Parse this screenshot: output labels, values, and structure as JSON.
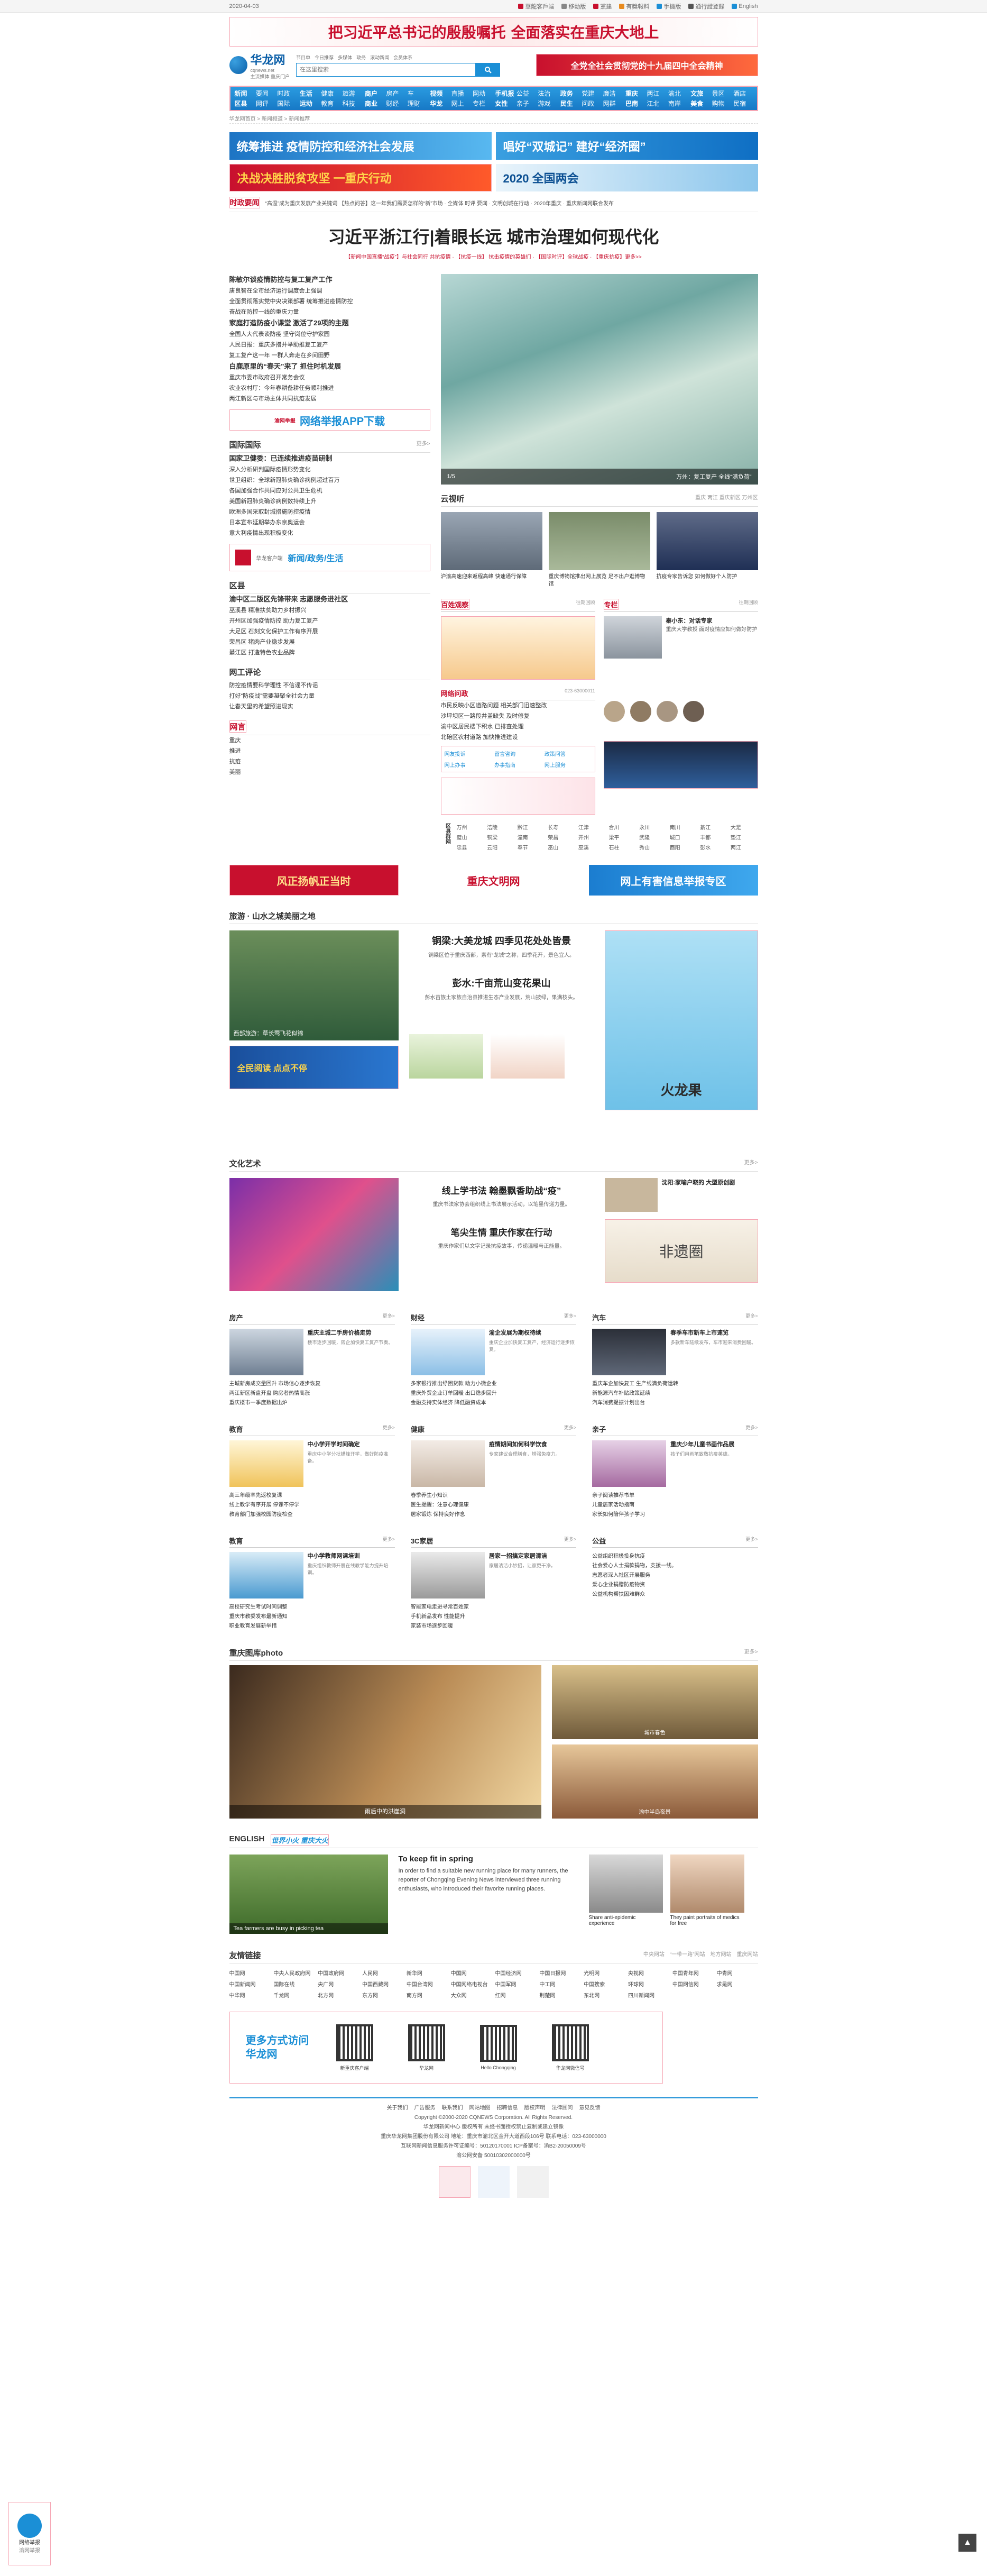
{
  "topbar": {
    "date": "2020-04-03",
    "links": [
      "華龍客戶端",
      "移動版",
      "黨建",
      "有獎報料",
      "手機版",
      "通行證登錄",
      "English"
    ]
  },
  "banner": {
    "text": "把习近平总书记的殷殷嘱托 全面落实在重庆大地上"
  },
  "header": {
    "logo_title": "华龙网",
    "logo_sub": "cqnews.net",
    "tagline": "主流媒体 重庆门户",
    "search_placeholder": "在这里搜索",
    "ad_text": "全党全社会贯彻党的十九届四中全会精神",
    "top_links": [
      "节目单",
      "今日推荐",
      "多媒体",
      "政务",
      "滚动新闻",
      "会员体系"
    ]
  },
  "nav": {
    "cols": [
      [
        "新闻",
        "要闻",
        "时政",
        "区县",
        "网评",
        "国际",
        "社会",
        "娱乐",
        "图片"
      ],
      [
        "生活",
        "健康",
        "旅游",
        "运动",
        "教育",
        "科技",
        "时尚",
        "文化",
        "美食"
      ],
      [
        "商户",
        "房产",
        "车",
        "商业",
        "财经",
        "理财",
        "互联",
        "数码",
        "专题"
      ],
      [
        "视频",
        "直播",
        "网动",
        "华龙",
        "网上",
        "专栏",
        "微博",
        "微信",
        "APP"
      ],
      [
        "手机报",
        "公益",
        "法治",
        "女性",
        "亲子",
        "游戏",
        "电竞",
        "音乐",
        "招聘"
      ],
      [
        "政务",
        "党建",
        "廉洁",
        "民生",
        "问政",
        "网群",
        "信用",
        "人社",
        "政策"
      ],
      [
        "重庆",
        "两江",
        "渝北",
        "巴南",
        "江北",
        "南岸",
        "渝中",
        "沙坪坝",
        "九龙坡"
      ],
      [
        "文旅",
        "景区",
        "酒店",
        "美食",
        "购物",
        "民宿",
        "节庆",
        "攻略",
        "专栏"
      ]
    ]
  },
  "crumb": "华龙网首页 > 新闻频道 > 新闻推荐",
  "promos": {
    "p1": "统筹推进 疫情防控和经济社会发展",
    "p2": "唱好“双城记” 建好“经济圈”",
    "p3": "决战决胜脱贫攻坚 一重庆行动",
    "p4": "2020 全国两会"
  },
  "ticker": {
    "label": "时政要闻",
    "text": "“高温”成为重庆发展产业关键词 【热点问答】这一年我们需要怎样的“新”市场 · 全媒体 时评 要闻 · 文明创城在行动 · 2020年重庆 · 重庆新闻网联合发布"
  },
  "headline": {
    "title": "习近平浙江行|着眼长远 城市治理如何现代化",
    "sub": "【新闻中国直播“战疫”】与社会同行 共抗疫情 · 【抗疫一线】 抗击疫情的英雄们 · 【国际时评】全球战疫 · 【重庆抗疫】更多>>"
  },
  "left_news": [
    {
      "t": "陈敏尔谈疫情防控与复工复产工作",
      "b": true
    },
    {
      "t": "唐良智在全市经济运行调度会上强调",
      "b": false
    },
    {
      "t": "全面贯彻落实党中央决策部署 统筹推进疫情防控",
      "b": false
    },
    {
      "t": "奋战在防控一线的重庆力量",
      "b": false
    },
    {
      "t": "家庭打造防疫小课堂 激活了29项的主题",
      "b": true
    },
    {
      "t": "全国人大代表谈防疫 坚守岗位守护家园",
      "b": false
    },
    {
      "t": "人民日报：重庆多措并举助推复工复产",
      "b": false
    },
    {
      "t": "复工复产这一年 一群人奔走在乡间田野",
      "b": false
    },
    {
      "t": "白鹿原里的“春天”来了 抓住时机发展",
      "b": true
    },
    {
      "t": "重庆市委市政府召开常务会议",
      "b": false
    },
    {
      "t": "农业农村厅：今年春耕备耕任务顺利推进",
      "b": false
    },
    {
      "t": "两江新区与市场主体共同抗疫发展",
      "b": false
    }
  ],
  "app_btn": {
    "text": "网络举报APP下载",
    "r": "渝网举报"
  },
  "slider": {
    "caption": "万州：复工复产 全线“满负荷”",
    "page": "1/5"
  },
  "cloud": {
    "title": "云视听",
    "tabs": [
      "重庆",
      "两江",
      "重庆新区",
      "万州区"
    ],
    "items": [
      {
        "t": "沪渝高速迎来返程高峰 快速通行保障"
      },
      {
        "t": "重庆博物馆推出网上展览 足不出户逛博物馆"
      },
      {
        "t": "抗疫专家告诉您 如何做好个人防护"
      }
    ]
  },
  "intl": {
    "title": "国际国际",
    "more": "更多>",
    "list": [
      "国家卫健委：已连续推进疫苗研制",
      "深入分析研判国际疫情形势变化",
      "世卫组织：全球新冠肺炎确诊病例超过百万",
      "各国加强合作共同应对公共卫生危机",
      "美国新冠肺炎确诊病例数持续上升",
      "欧洲多国采取封城措施防控疫情",
      "日本宣布延期举办东京奥运会",
      "意大利疫情出现积极变化"
    ]
  },
  "entries": {
    "a": "新闻/政务/生活",
    "b": "华龙客户端"
  },
  "districts": {
    "title": "区县",
    "list": [
      "渝中区二版区先锋带来 志愿服务进社区",
      "巫溪县 精准扶贫助力乡村振兴",
      "开州区加强疫情防控 助力复工复产",
      "大足区 石刻文化保护工作有序开展",
      "荣昌区 猪肉产业稳步发展",
      "綦江区 打造特色农业品牌"
    ]
  },
  "comment": {
    "title": "网工评论",
    "list": [
      "防控疫情要科学理性 不信谣不传谣",
      "打好“防疫战”需要凝聚全社会力量",
      "让春天里的希望照进现实"
    ]
  },
  "cloud_sub": {
    "title": "网言",
    "q": "主持人",
    "list": [
      "重庆",
      "推进",
      "抗疫",
      "美丽"
    ]
  },
  "right_small": {
    "hehe_title": "百姓观察",
    "hehe_more": "往期回顾",
    "expert_title": "专栏",
    "expert_more": "往期回顾",
    "expert_name": "秦小东：对话专家",
    "expert_desc": "重庆大学教授 面对疫情应如何做好防护",
    "wang": "网络问政",
    "hotline": "023-63000011",
    "wang_list": [
      "市民反映小区道路问题 相关部门迅速整改",
      "沙坪坝区一路段井盖缺失 及时修复",
      "渝中区居民楼下积水 已排查处理",
      "北碚区农村道路 加快推进建设"
    ],
    "wang_btns": [
      "网友投诉",
      "留言咨询",
      "政策问答",
      "网上办事",
      "办事指南",
      "网上服务"
    ]
  },
  "region_grid": {
    "title": "区县群网",
    "names": [
      "万州",
      "涪陵",
      "黔江",
      "长寿",
      "江津",
      "合川",
      "永川",
      "南川",
      "綦江",
      "大足",
      "璧山",
      "铜梁",
      "潼南",
      "荣昌",
      "开州",
      "梁平",
      "武隆",
      "城口",
      "丰都",
      "垫江",
      "忠县",
      "云阳",
      "奉节",
      "巫山",
      "巫溪",
      "石柱",
      "秀山",
      "酉阳",
      "彭水",
      "两江"
    ]
  },
  "bars": {
    "b1": "风正扬帆正当时",
    "b2": "重庆文明网",
    "b3": "网上有害信息举报专区"
  },
  "travel": {
    "title": "旅游 · 山水之城美丽之地",
    "h1": "铜梁:大美龙城 四季见花处处皆景",
    "p1": "铜梁区位于重庆西部，素有“龙城”之称，四季花开，景色宜人。",
    "h2": "彭水:千亩荒山变花果山",
    "p2": "彭水苗族土家族自治县推进生态产业发展，荒山披绿，果满枝头。",
    "cap": "西部旅游：草长莺飞花似锦",
    "ad1": "全民阅读 点点不停",
    "side_ad": "火龙果"
  },
  "culture": {
    "title": "文化艺术",
    "more": "更多>",
    "h1": "线上学书法 翰墨飘香助战“疫”",
    "p1": "重庆书法家协会组织线上书法展示活动，以笔墨传递力量。",
    "h2": "笔尖生情 重庆作家在行动",
    "p2": "重庆作家们以文字记录抗疫故事，传递温暖与正能量。",
    "side_h": "沈阳:家喻户晓的 大型原创剧",
    "side_sub": "非遗圈"
  },
  "cats": [
    {
      "title": "房产",
      "more": "更多>",
      "h": "重庆主城二手房价格走势",
      "p": "楼市逐步回暖，房企加快复工复产节奏。",
      "list": [
        "主城新房成交量回升 市场信心逐步恢复",
        "两江新区新盘开盘 购房者热情高涨",
        "重庆楼市一季度数据出炉"
      ]
    },
    {
      "title": "财经",
      "more": "更多>",
      "h": "渝企发展为期权待续",
      "p": "重庆企业加快复工复产，经济运行逐步恢复。",
      "list": [
        "多家银行推出纾困贷款 助力小微企业",
        "重庆外贸企业订单回暖 出口稳步回升",
        "金融支持实体经济 降低融资成本"
      ]
    },
    {
      "title": "汽车",
      "more": "更多>",
      "h": "春季车市新车上市速览",
      "p": "多款新车陆续发布，车市迎来消费回暖。",
      "list": [
        "重庆车企加快复工 生产线满负荷运转",
        "新能源汽车补贴政策延续",
        "汽车消费提振计划出台"
      ]
    },
    {
      "title": "教育",
      "more": "更多>",
      "h": "中小学开学时间确定",
      "p": "重庆中小学分批错峰开学，做好防疫准备。",
      "list": [
        "高三年级率先返校复课",
        "线上教学有序开展 停课不停学",
        "教育部门加强校园防疫检查"
      ]
    },
    {
      "title": "健康",
      "more": "更多>",
      "h": "疫情期间如何科学饮食",
      "p": "专家建议合理膳食，增强免疫力。",
      "list": [
        "春季养生小知识",
        "医生提醒：注意心理健康",
        "居家锻炼 保持良好作息"
      ]
    },
    {
      "title": "亲子",
      "more": "更多>",
      "h": "重庆少年儿童书画作品展",
      "p": "孩子们用画笔致敬抗疫英雄。",
      "list": [
        "亲子阅读推荐书单",
        "儿童居家活动指南",
        "家长如何陪伴孩子学习"
      ]
    },
    {
      "title": "教育",
      "more": "更多>",
      "h": "中小学教师网课培训",
      "p": "重庆组织教师开展在线教学能力提升培训。",
      "list": [
        "高校研究生考试时间调整",
        "重庆市教委发布最新通知",
        "职业教育发展新举措"
      ]
    },
    {
      "title": "3C家居",
      "more": "更多>",
      "h": "居家一招搞定家居清洁",
      "p": "家居清洁小妙招，让家更干净。",
      "list": [
        "智能家电走进寻常百姓家",
        "手机新品发布 性能提升",
        "家装市场逐步回暖"
      ]
    },
    {
      "title": "公益",
      "more": "更多>",
      "h": "公益组织积极投身抗疫",
      "p": "社会爱心人士捐款捐物，支援一线。",
      "list": [
        "志愿者深入社区开展服务",
        "爱心企业捐赠防疫物资",
        "公益机构帮扶困难群众"
      ]
    }
  ],
  "photo": {
    "title": "重庆图库photo",
    "more": "更多>",
    "cap1": "雨后中的洪崖洞",
    "cap2": "渝中半岛夜景",
    "cap3": "城市春色"
  },
  "english": {
    "title": "ENGLISH",
    "sub": "世界小火 重庆大火",
    "h": "To keep fit in spring",
    "p": "In order to find a suitable new running place for many runners, the reporter of Chongqing Evening News interviewed three running enthusiasts, who introduced their favorite running places.",
    "cap": "Tea farmers are busy in picking tea",
    "c2": "Share anti-epidemic experience",
    "c3": "They paint portraits of medics for free"
  },
  "friends": {
    "title": "友情链接",
    "tabs": [
      "中央网站",
      "“一带一路”网站",
      "地方网站",
      "重庆网站"
    ],
    "list": [
      "中国网",
      "中央人民政府网",
      "中国政府网",
      "人民网",
      "新华网",
      "中国网",
      "中国经济网",
      "中国日报网",
      "光明网",
      "央视网",
      "中国青年网",
      "中青网",
      "中国新闻网",
      "国际在线",
      "央广网",
      "中国西藏网",
      "中国台湾网",
      "中国网络电视台",
      "中国军网",
      "中工网",
      "中国搜索",
      "环球网",
      "中国网信网",
      "求是网",
      "中华网",
      "千龙网",
      "北方网",
      "东方网",
      "南方网",
      "大众网",
      "红网",
      "荆楚网",
      "东北网",
      "四川新闻网"
    ]
  },
  "qrs": {
    "lead": "更多方式访问华龙网",
    "items": [
      "新重庆客户端",
      "华龙网",
      "Hello Chongqing",
      "华龙网微信号"
    ]
  },
  "footer": {
    "links": [
      "关于我们",
      "广告服务",
      "联系我们",
      "网站地图",
      "招聘信息",
      "版权声明",
      "法律顾问",
      "意见反馈"
    ],
    "l1": "Copyright ©2000-2020 CQNEWS Corporation. All Rights Reserved.",
    "l2": "华龙网新闻中心 版权所有 未经书面授权禁止复制或建立镜像",
    "l3": "重庆华龙网集团股份有限公司 地址：重庆市渝北区金开大道西段106号 联系电话：023-63000000",
    "l4": "互联网新闻信息服务许可证编号：50120170001 ICP备案号：渝B2-20050009号",
    "l5": "渝公网安备 50010302000000号"
  },
  "fixed_left": {
    "t": "网络举报",
    "s": "渝网举报"
  }
}
